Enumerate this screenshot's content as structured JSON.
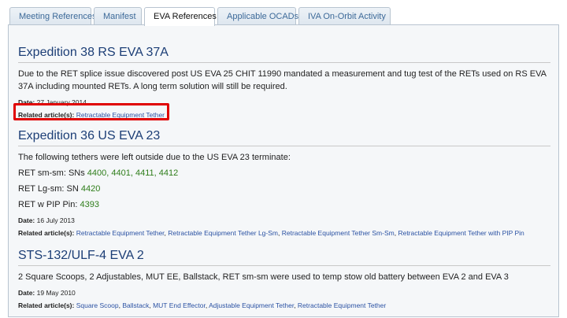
{
  "tabs": [
    {
      "label": "Meeting References",
      "active": false
    },
    {
      "label": "Manifest",
      "active": false
    },
    {
      "label": "EVA References",
      "active": true
    },
    {
      "label": "Applicable OCADs",
      "active": false
    },
    {
      "label": "IVA On-Orbit Activity",
      "active": false
    }
  ],
  "labels": {
    "date": "Date:",
    "related": "Related article(s):"
  },
  "sections": [
    {
      "title": "Expedition 38 RS EVA 37A",
      "body": "Due to the RET splice issue discovered post US EVA 25 CHIT 11990 mandated a measurement and tug test of the RETs used on RS EVA 37A including mounted RETs.  A long term solution will still be required.",
      "date": "27 January 2014",
      "related": [
        "Retractable Equipment Tether"
      ]
    },
    {
      "title": "Expedition 36 US EVA 23",
      "intro": "The following tethers were left outside due to the US EVA 23 terminate:",
      "lines": [
        {
          "label": "RET sm-sm: SNs ",
          "sns": "4400, 4401, 4411, 4412"
        },
        {
          "label": "RET Lg-sm: SN ",
          "sns": "4420"
        },
        {
          "label": "RET w PIP Pin: ",
          "sns": "4393"
        }
      ],
      "date": "16 July 2013",
      "related": [
        "Retractable Equipment Tether",
        "Retractable Equipment Tether Lg-Sm",
        "Retractable Equipment Tether Sm-Sm",
        "Retractable Equipment Tether with PIP Pin"
      ]
    },
    {
      "title": "STS-132/ULF-4 EVA 2",
      "body": "2 Square Scoops, 2 Adjustables, MUT EE, Ballstack, RET sm-sm were used to temp stow old battery between EVA 2 and EVA 3",
      "date": "19 May 2010",
      "related": [
        "Square Scoop",
        "Ballstack",
        "MUT End Effector",
        "Adjustable Equipment Tether",
        "Retractable Equipment Tether"
      ]
    }
  ],
  "colors": {
    "tab_text": "#3d6a99",
    "heading": "#1c3e76",
    "link": "#2b52a3",
    "serial": "#2e7d1a",
    "highlight": "#e00000"
  }
}
